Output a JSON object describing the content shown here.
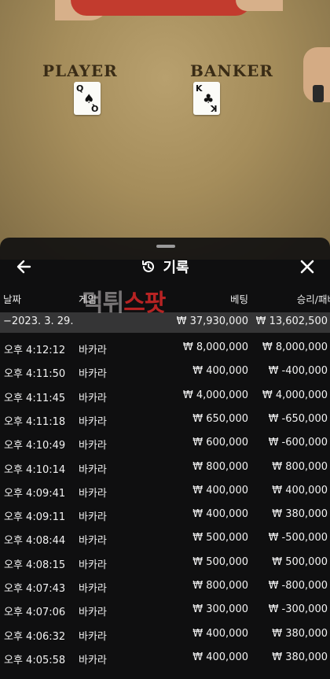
{
  "background": {
    "player_label": "PLAYER",
    "banker_label": "BANKER",
    "player_card": {
      "rank": "Q",
      "suit": "♠"
    },
    "banker_card": {
      "rank": "K",
      "suit": "♣"
    }
  },
  "header": {
    "title": "기록",
    "back_icon": "arrow-left-icon",
    "history_icon": "history-icon",
    "close_icon": "close-icon"
  },
  "columns": {
    "date": "날짜",
    "game": "게임",
    "bet": "베팅",
    "result": "승리/패배"
  },
  "watermark": {
    "part1": "먹튀",
    "part2": "스팟"
  },
  "summary": {
    "date": "−2023. 3. 29.",
    "bet": "₩ 37,930,000",
    "result": "₩ 13,602,500"
  },
  "rows": [
    {
      "time": "오후 4:12:12",
      "game": "바카라",
      "bet": "₩ 8,000,000",
      "result": "₩ 8,000,000"
    },
    {
      "time": "오후 4:11:50",
      "game": "바카라",
      "bet": "₩ 400,000",
      "result": "₩ -400,000"
    },
    {
      "time": "오후 4:11:45",
      "game": "바카라",
      "bet": "₩ 4,000,000",
      "result": "₩ 4,000,000"
    },
    {
      "time": "오후 4:11:18",
      "game": "바카라",
      "bet": "₩ 650,000",
      "result": "₩ -650,000"
    },
    {
      "time": "오후 4:10:49",
      "game": "바카라",
      "bet": "₩ 600,000",
      "result": "₩ -600,000"
    },
    {
      "time": "오후 4:10:14",
      "game": "바카라",
      "bet": "₩ 800,000",
      "result": "₩ 800,000"
    },
    {
      "time": "오후 4:09:41",
      "game": "바카라",
      "bet": "₩ 400,000",
      "result": "₩ 400,000"
    },
    {
      "time": "오후 4:09:11",
      "game": "바카라",
      "bet": "₩ 400,000",
      "result": "₩ 380,000"
    },
    {
      "time": "오후 4:08:44",
      "game": "바카라",
      "bet": "₩ 500,000",
      "result": "₩ -500,000"
    },
    {
      "time": "오후 4:08:15",
      "game": "바카라",
      "bet": "₩ 500,000",
      "result": "₩ 500,000"
    },
    {
      "time": "오후 4:07:43",
      "game": "바카라",
      "bet": "₩ 800,000",
      "result": "₩ -800,000"
    },
    {
      "time": "오후 4:07:06",
      "game": "바카라",
      "bet": "₩ 300,000",
      "result": "₩ -300,000"
    },
    {
      "time": "오후 4:06:32",
      "game": "바카라",
      "bet": "₩ 400,000",
      "result": "₩ 380,000"
    },
    {
      "time": "오후 4:05:58",
      "game": "바카라",
      "bet": "₩ 400,000",
      "result": "₩ 380,000"
    }
  ]
}
